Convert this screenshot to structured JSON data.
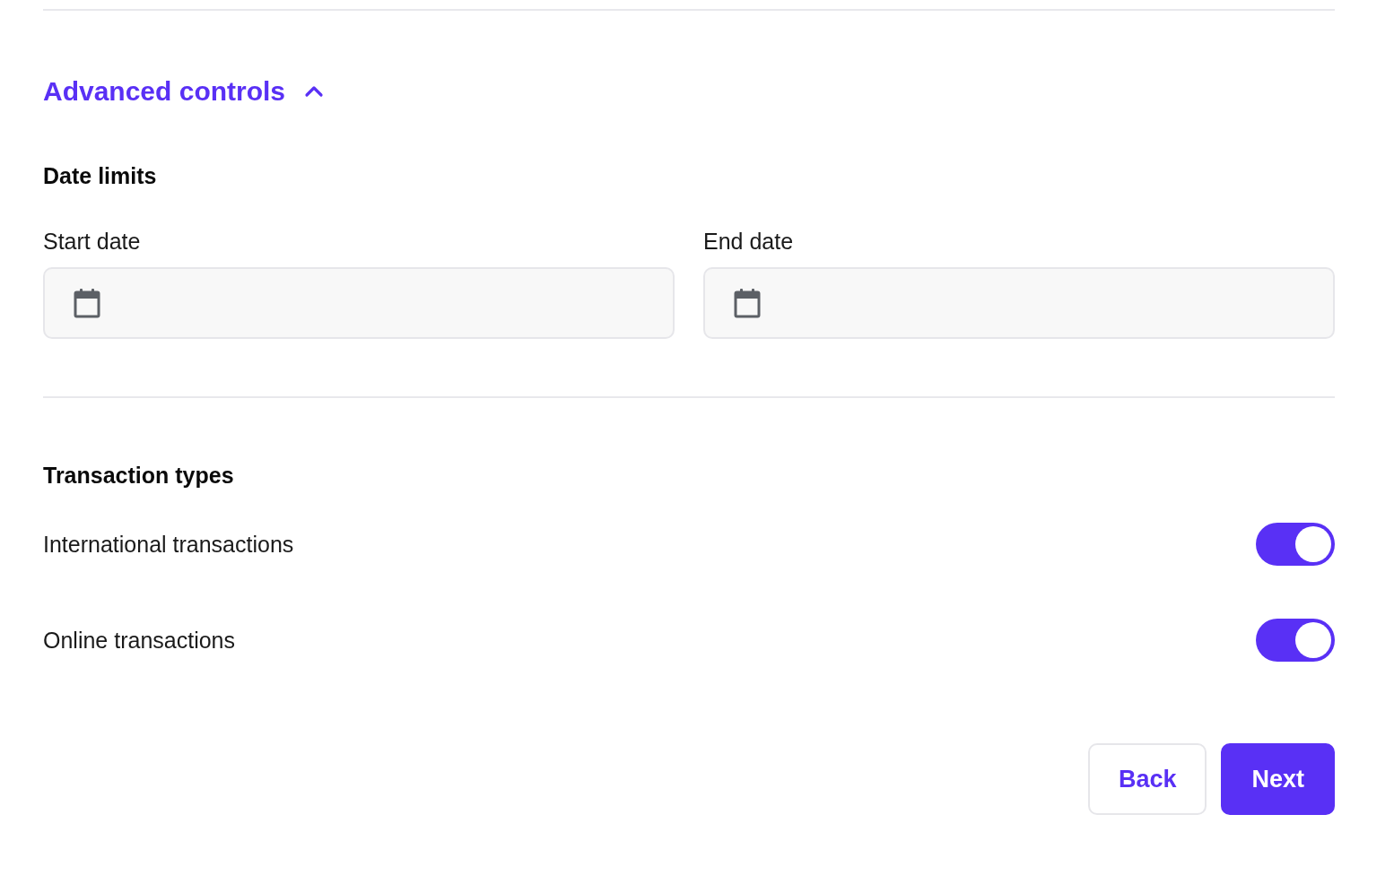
{
  "advanced_controls": {
    "label": "Advanced controls",
    "expanded": true
  },
  "date_limits": {
    "heading": "Date limits",
    "fields": [
      {
        "label": "Start date"
      },
      {
        "label": "End date"
      }
    ]
  },
  "transaction_types": {
    "heading": "Transaction types",
    "toggles": [
      {
        "label": "International transactions",
        "on": true
      },
      {
        "label": "Online transactions",
        "on": true
      }
    ]
  },
  "buttons": [
    {
      "label": "Back",
      "kind": "secondary"
    },
    {
      "label": "Next",
      "kind": "primary"
    }
  ]
}
